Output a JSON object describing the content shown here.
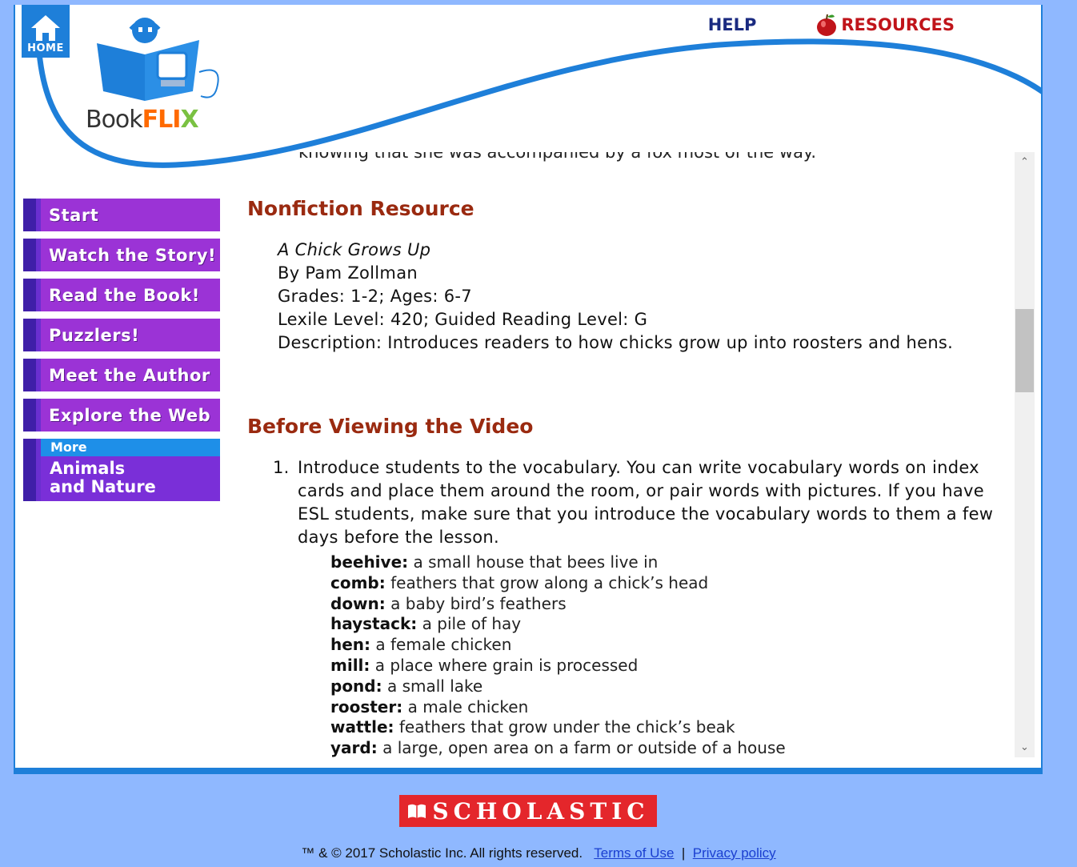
{
  "header": {
    "home_label": "HOME",
    "help_label": "HELP",
    "resources_label": "RESOURCES",
    "logo_book": "Book",
    "logo_fli": "FLI",
    "logo_x": "X"
  },
  "nav": {
    "items": [
      {
        "label": "Start"
      },
      {
        "label": "Watch the Story!"
      },
      {
        "label": "Read the Book!"
      },
      {
        "label": "Puzzlers!"
      },
      {
        "label": "Meet the Author"
      },
      {
        "label": "Explore the Web"
      }
    ],
    "more": {
      "label": "More",
      "title_line1": "Animals",
      "title_line2": "and Nature"
    }
  },
  "content": {
    "cut_line": "knowing that she was accompanied by a fox most of the way.",
    "nonfiction_heading": "Nonfiction Resource",
    "resource": {
      "title": "A Chick Grows Up",
      "author": "By Pam Zollman",
      "grades": "Grades: 1-2; Ages: 6-7",
      "lexile": "Lexile Level: 420; Guided Reading Level: G",
      "description": "Description: Introduces readers to how chicks grow up into roosters and hens."
    },
    "before_heading": "Before Viewing the Video",
    "steps": [
      {
        "num": "1.",
        "text": "Introduce students to the vocabulary. You can write vocabulary words on index cards and place them around the room, or pair words with pictures. If you have ESL students, make sure that you introduce the vocabulary words to them a few days before the lesson."
      }
    ],
    "vocab": [
      {
        "term": "beehive:",
        "def": "a small house that bees live in"
      },
      {
        "term": "comb:",
        "def": "feathers that grow along a chick’s head"
      },
      {
        "term": "down:",
        "def": "a baby bird’s feathers"
      },
      {
        "term": "haystack:",
        "def": "a pile of hay"
      },
      {
        "term": "hen:",
        "def": "a female chicken"
      },
      {
        "term": "mill:",
        "def": "a place where grain is processed"
      },
      {
        "term": "pond:",
        "def": "a small lake"
      },
      {
        "term": "rooster:",
        "def": "a male chicken"
      },
      {
        "term": "wattle:",
        "def": "feathers that grow under the chick’s beak"
      },
      {
        "term": "yard:",
        "def": "a large, open area on a farm or outside of a house"
      }
    ]
  },
  "footer": {
    "logo_text": "SCHOLASTIC",
    "copyright": "™ & © 2017 Scholastic Inc. All rights reserved.",
    "terms_label": "Terms of Use",
    "separator": "|",
    "privacy_label": "Privacy policy"
  },
  "colors": {
    "page_bg": "#8fb8ff",
    "frame_blue": "#1e7fd9",
    "nav_purple": "#9b33d6",
    "heading_red": "#9a2a10",
    "scholastic_red": "#e4262b"
  },
  "icons": [
    "home-icon",
    "apple-icon",
    "chevron-up-icon",
    "chevron-down-icon",
    "scholastic-book-icon"
  ]
}
